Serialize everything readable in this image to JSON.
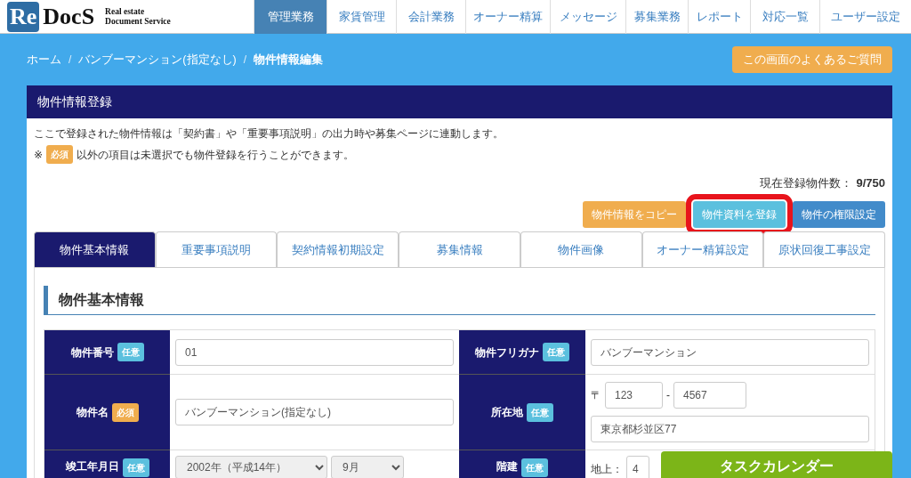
{
  "logo": {
    "mark": "Re",
    "word": "DocS",
    "tagline_1": "Real estate",
    "tagline_2": "Document Service"
  },
  "nav": [
    {
      "label": "管理業務",
      "selected": true
    },
    {
      "label": "家賃管理",
      "selected": false
    },
    {
      "label": "会計業務",
      "selected": false
    },
    {
      "label": "オーナー精算",
      "selected": false
    },
    {
      "label": "メッセージ",
      "selected": false
    },
    {
      "label": "募集業務",
      "selected": false
    },
    {
      "label": "レポート",
      "selected": false
    },
    {
      "label": "対応一覧",
      "selected": false
    },
    {
      "label": "ユーザー設定",
      "selected": false
    }
  ],
  "breadcrumb_separator": "/",
  "breadcrumb": [
    {
      "label": "ホーム",
      "current": false
    },
    {
      "label": "バンブーマンション(指定なし)",
      "current": false
    },
    {
      "label": "物件情報編集",
      "current": true
    }
  ],
  "faq_button": "この画面のよくあるご質問",
  "panel_title": "物件情報登録",
  "intro": "ここで登録された物件情報は「契約書」や「重要事項説明」の出力時や募集ページに連動します。",
  "note": {
    "mark": "※",
    "badge": "必須",
    "text": "以外の項目は未選択でも物件登録を行うことができます。"
  },
  "count": {
    "label": "現在登録物件数：",
    "value": "9/750"
  },
  "actions": [
    {
      "label": "物件情報をコピー",
      "kind": "warning",
      "highlighted": false
    },
    {
      "label": "物件資料を登録",
      "kind": "info",
      "highlighted": true
    },
    {
      "label": "物件の権限設定",
      "kind": "primary",
      "highlighted": false
    }
  ],
  "tabs": [
    {
      "label": "物件基本情報",
      "selected": true
    },
    {
      "label": "重要事項説明",
      "selected": false
    },
    {
      "label": "契約情報初期設定",
      "selected": false
    },
    {
      "label": "募集情報",
      "selected": false
    },
    {
      "label": "物件画像",
      "selected": false
    },
    {
      "label": "オーナー精算設定",
      "selected": false
    },
    {
      "label": "原状回復工事設定",
      "selected": false
    }
  ],
  "section_title": "物件基本情報",
  "rows": [
    [
      {
        "label": "物件番号",
        "badge": "任意",
        "required": false,
        "kind": "text",
        "value": "01"
      },
      {
        "label": "物件フリガナ",
        "badge": "任意",
        "required": false,
        "kind": "text",
        "value": "バンブーマンション"
      }
    ],
    [
      {
        "label": "物件名",
        "badge": "必須",
        "required": true,
        "kind": "text",
        "value": "バンブーマンション(指定なし)"
      },
      {
        "label": "所在地",
        "badge": "任意",
        "required": false,
        "kind": "address",
        "postal_mark": "〒",
        "postal_1": "123",
        "separator": "-",
        "postal_2": "4567",
        "value": "東京都杉並区77"
      }
    ],
    [
      {
        "label": "竣工年月日",
        "badge": "任意",
        "required": false,
        "kind": "date",
        "year": "2002年（平成14年）",
        "month": "9月"
      },
      {
        "label": "階建",
        "badge": "任意",
        "required": false,
        "kind": "floors",
        "prefix": "地上：",
        "value": "4"
      }
    ]
  ],
  "task_calendar": "タスクカレンダー"
}
